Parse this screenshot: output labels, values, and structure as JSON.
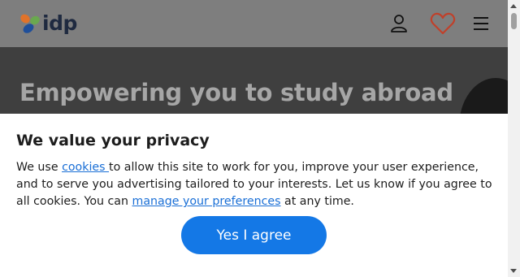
{
  "header": {
    "logo_text": "idp",
    "icons": [
      "user-icon",
      "heart-icon",
      "menu-icon"
    ],
    "heart_color": "#c0402a"
  },
  "hero": {
    "title": "Empowering you to study abroad"
  },
  "privacy": {
    "title": "We value your privacy",
    "text_1": "We use ",
    "cookies_link": "cookies ",
    "text_2": "to allow this site to work for you, improve your user experience, and to serve you advertising tailored to your interests. Let us know if you agree to all cookies. You can ",
    "preferences_link": "manage your preferences",
    "text_3": " at any time.",
    "agree_button": "Yes I agree",
    "button_color": "#1478e6",
    "link_color": "#1a6fd6"
  }
}
